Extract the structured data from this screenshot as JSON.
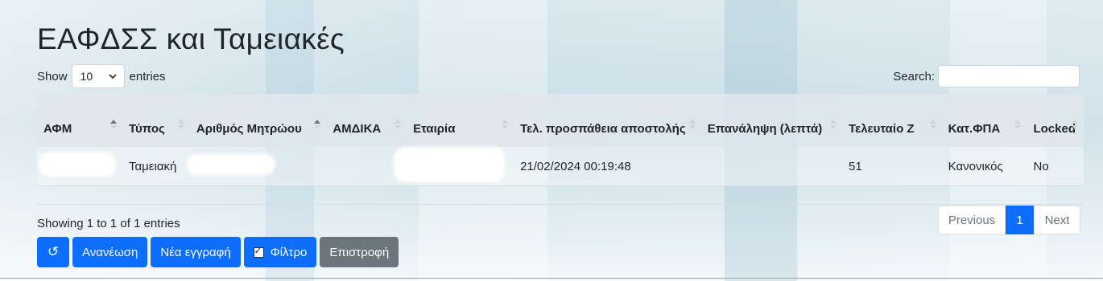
{
  "page": {
    "title": "ΕΑΦΔΣΣ και Ταμειακές"
  },
  "length": {
    "prefix": "Show",
    "selected": "10",
    "suffix": "entries"
  },
  "search": {
    "label": "Search:",
    "value": ""
  },
  "table": {
    "columns": [
      {
        "label": "ΑΦΜ",
        "sort": "asc"
      },
      {
        "label": "Τύπος",
        "sort": "both"
      },
      {
        "label": "Αριθμός Μητρώου",
        "sort": "asc"
      },
      {
        "label": "ΑΜΔΙΚΑ",
        "sort": "both"
      },
      {
        "label": "Εταιρία",
        "sort": "both"
      },
      {
        "label": "Τελ. προσπάθεια αποστολής",
        "sort": "both"
      },
      {
        "label": "Επανάληψη (λεπτά)",
        "sort": "both"
      },
      {
        "label": "Τελευταίο Ζ",
        "sort": "both"
      },
      {
        "label": "Κατ.ΦΠΑ",
        "sort": "both"
      },
      {
        "label": "Locked",
        "sort": "both"
      }
    ],
    "rows": [
      {
        "afm": "",
        "type": "Ταμειακή",
        "registry": "",
        "amdika": "",
        "company": "",
        "last_attempt": "21/02/2024 00:19:48",
        "repeat_minutes": "",
        "last_z": "51",
        "vat_category": "Κανονικός",
        "locked": "No"
      }
    ]
  },
  "info": "Showing 1 to 1 of 1 entries",
  "pagination": {
    "previous": "Previous",
    "current": "1",
    "next": "Next"
  },
  "buttons": {
    "reload_icon": "↺",
    "refresh": "Ανανέωση",
    "new_record": "Νέα εγγραφή",
    "filter": "Φίλτρο",
    "back": "Επιστροφή"
  },
  "icons": {
    "sort": "sort-icon",
    "dropdown": "chevron-down-icon",
    "reload": "reload-icon",
    "filter_checkbox": "checkbox-checked-icon"
  },
  "colors": {
    "primary": "#0d6efd",
    "secondary": "#6c757d"
  }
}
